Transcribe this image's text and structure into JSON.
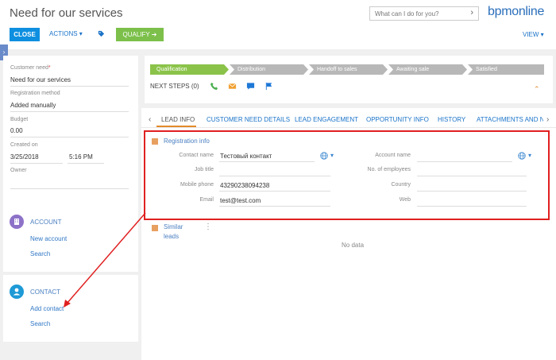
{
  "header": {
    "title": "Need for our services",
    "search_placeholder": "What can I do for you?",
    "logo": "bpmonline",
    "close_label": "CLOSE",
    "actions_label": "ACTIONS ▾",
    "qualify_label": "QUALIFY ➔",
    "view_label": "VIEW ▾"
  },
  "left_panel": {
    "tab_glyph": "›",
    "fields": [
      {
        "label": "Customer need",
        "required_mark": "*",
        "value": "Need for our services"
      },
      {
        "label": "Registration method",
        "value": "Added manually"
      },
      {
        "label": "Budget",
        "value": "0.00"
      },
      {
        "label": "Created on",
        "date": "3/25/2018",
        "time": "5:16 PM"
      },
      {
        "label": "Owner",
        "value": ""
      }
    ],
    "account": {
      "title": "ACCOUNT",
      "link1": "New account",
      "link2": "Search"
    },
    "contact": {
      "title": "CONTACT",
      "link1": "Add contact",
      "link2": "Search"
    }
  },
  "stages": [
    "Qualification",
    "Distribution",
    "Handoff to sales",
    "Awaiting sale",
    "Satisfied"
  ],
  "next_steps_label": "NEXT STEPS (0)",
  "tabs": {
    "items": [
      "LEAD INFO",
      "CUSTOMER NEED DETAILS",
      "LEAD ENGAGEMENT",
      "OPPORTUNITY INFO",
      "HISTORY",
      "ATTACHMENTS AND N"
    ],
    "prev": "‹",
    "next": "›"
  },
  "registration_info": {
    "title": "Registration info",
    "left": [
      {
        "label": "Contact name",
        "value": "Тестовый контакт"
      },
      {
        "label": "Job title",
        "value": ""
      },
      {
        "label": "Mobile phone",
        "value": "43290238094238"
      },
      {
        "label": "Email",
        "value": "test@test.com"
      }
    ],
    "right": [
      {
        "label": "Account name",
        "value": ""
      },
      {
        "label": "No. of employees",
        "value": ""
      },
      {
        "label": "Country",
        "value": ""
      },
      {
        "label": "Web",
        "value": ""
      }
    ]
  },
  "similar_leads": {
    "title_line1": "Similar",
    "title_line2": "leads",
    "empty": "No data",
    "menu": "⋮"
  },
  "colors": {
    "accent": "#0e8fe0",
    "qualify": "#7cc04b",
    "stage_active": "#8bc34a",
    "stage_inactive": "#b8b8b8",
    "highlight": "#e02020"
  }
}
